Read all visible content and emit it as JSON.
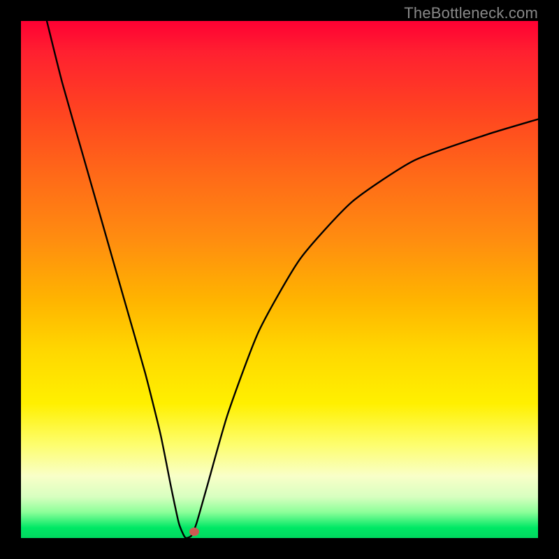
{
  "watermark": "TheBottleneck.com",
  "chart_data": {
    "type": "line",
    "title": "",
    "xlabel": "",
    "ylabel": "",
    "xlim": [
      0,
      100
    ],
    "ylim": [
      0,
      100
    ],
    "grid": false,
    "legend": false,
    "series": [
      {
        "name": "bottleneck-curve",
        "x": [
          5,
          8,
          12,
          16,
          20,
          24,
          27,
          29,
          30.5,
          31.5,
          32,
          33,
          34,
          36,
          40,
          46,
          54,
          64,
          76,
          90,
          100
        ],
        "y": [
          100,
          88,
          74,
          60,
          46,
          32,
          20,
          10,
          3,
          0.5,
          0,
          0.5,
          3,
          10,
          24,
          40,
          54,
          65,
          73,
          78,
          81
        ]
      }
    ],
    "marker": {
      "x": 33.5,
      "y": 1.2,
      "color": "#cc5a52"
    },
    "gradient_meaning": "vertical color gradient from red (top, high bottleneck) to green (bottom, no bottleneck)"
  }
}
